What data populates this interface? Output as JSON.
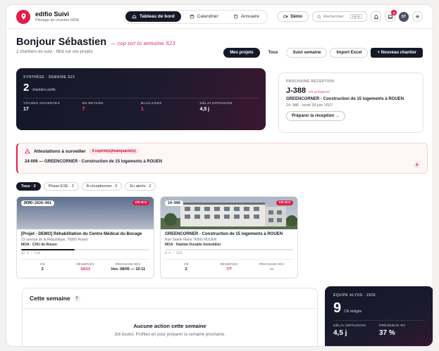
{
  "brand": {
    "name": "edifio Suivi",
    "subtitle": "Pilotage de chantier MOE"
  },
  "nav": [
    {
      "label": "Tableau de bord",
      "active": true
    },
    {
      "label": "Calendrier",
      "active": false
    },
    {
      "label": "Annuaire",
      "active": false
    }
  ],
  "topbar": {
    "demo_label": "Démo",
    "search_placeholder": "Rechercher",
    "search_shortcut": "Ctrl K",
    "notif_count": "2",
    "avatar_initials": "ST"
  },
  "greeting": {
    "title": "Bonjour Sébastien",
    "cap": "— cap sur la semaine S23",
    "subtitle": "2 chantiers en suivi · filtré sur vos projets"
  },
  "filters": {
    "mine": "Mes projets",
    "all": "Tous",
    "weekly": "Suivi semaine",
    "import": "Import Excel",
    "new": "+ Nouveau chantier"
  },
  "summary": {
    "label": "SYNTHÈSE · SEMAINE S23",
    "count": "2",
    "count_label": "chantiers actifs",
    "stats": [
      {
        "label": "TÂCHES OUVERTES",
        "value": "17",
        "alert": false
      },
      {
        "label": "EN RETARD",
        "value": "7",
        "alert": true
      },
      {
        "label": "BLOCAGES",
        "value": "1",
        "alert": true
      },
      {
        "label": "DÉLAI DIFFUSION",
        "value": "4,5 j",
        "alert": false
      }
    ]
  },
  "reception": {
    "label": "PROCHAINE RÉCEPTION",
    "countdown": "J-388",
    "status": "en préparer",
    "project": "GREENCORNER - Construction de 15 logements à ROUEN",
    "code": "24-986",
    "date": "lundi 28 juin 2027",
    "cta": "Préparer la réception →"
  },
  "attestations": {
    "title": "Attestations à surveiller",
    "tag": "4 expirée(s)/manquante(s)",
    "line": "24-006 — GREENCORNER - Construction de 15 logements à ROUEN",
    "count": "4"
  },
  "tabs": [
    {
      "label": "Tous · 2",
      "active": true
    },
    {
      "label": "Phase EXE · 2",
      "active": false
    },
    {
      "label": "À réceptionner · 0",
      "active": false
    },
    {
      "label": "En alerte · 2",
      "active": false
    }
  ],
  "projects": [
    {
      "code": "DEMO-2026-001",
      "cr": "CR N°2",
      "name": "[Projet - DEMO] Réhabilitation du Centre Médical du Bocage",
      "address": "23 avenue de la République, 76000 Rouen",
      "moa": "MOA · CHU de Rouen",
      "progress": 0.42,
      "progress_text": "42 % · S18",
      "footer": [
        {
          "label": "CR",
          "value": "2",
          "alert": false
        },
        {
          "label": "RÉSERVES",
          "value": "10/13",
          "alert": true
        },
        {
          "label": "PROCHAIN RDV",
          "value": "Ven. 08/05 — 10:11",
          "alert": false
        }
      ]
    },
    {
      "code": "24-986",
      "cr": "CR N°2",
      "name": "GREENCORNER - Construction de 15 logements à ROUEN",
      "address": "Rue Sainte Marie 76000 ROUEN",
      "moa": "MOA · Habitat Durable Immobilier",
      "progress": 0.0,
      "progress_text": "0 % · S23",
      "footer": [
        {
          "label": "CR",
          "value": "2",
          "alert": false
        },
        {
          "label": "RÉSERVES",
          "value": "7/7",
          "alert": true
        },
        {
          "label": "PROCHAIN RDV",
          "value": "—",
          "alert": false
        }
      ]
    }
  ],
  "week": {
    "title": "Cette semaine",
    "count": "0",
    "empty_title": "Aucune action cette semaine",
    "empty_sub": "Joli boulot. Profitez-en pour préparer la semaine prochaine."
  },
  "team": {
    "label": "ÉQUIPE ALYOS · 2026",
    "count": "9",
    "count_label": "CR rédigés",
    "stats": [
      {
        "label": "DÉLAI DIFFUSION",
        "value": "4,5 j"
      },
      {
        "label": "PRÉSENCE RC",
        "value": "37 %"
      }
    ]
  },
  "colors": {
    "accent": "#e11d48",
    "dark": "#151826"
  }
}
